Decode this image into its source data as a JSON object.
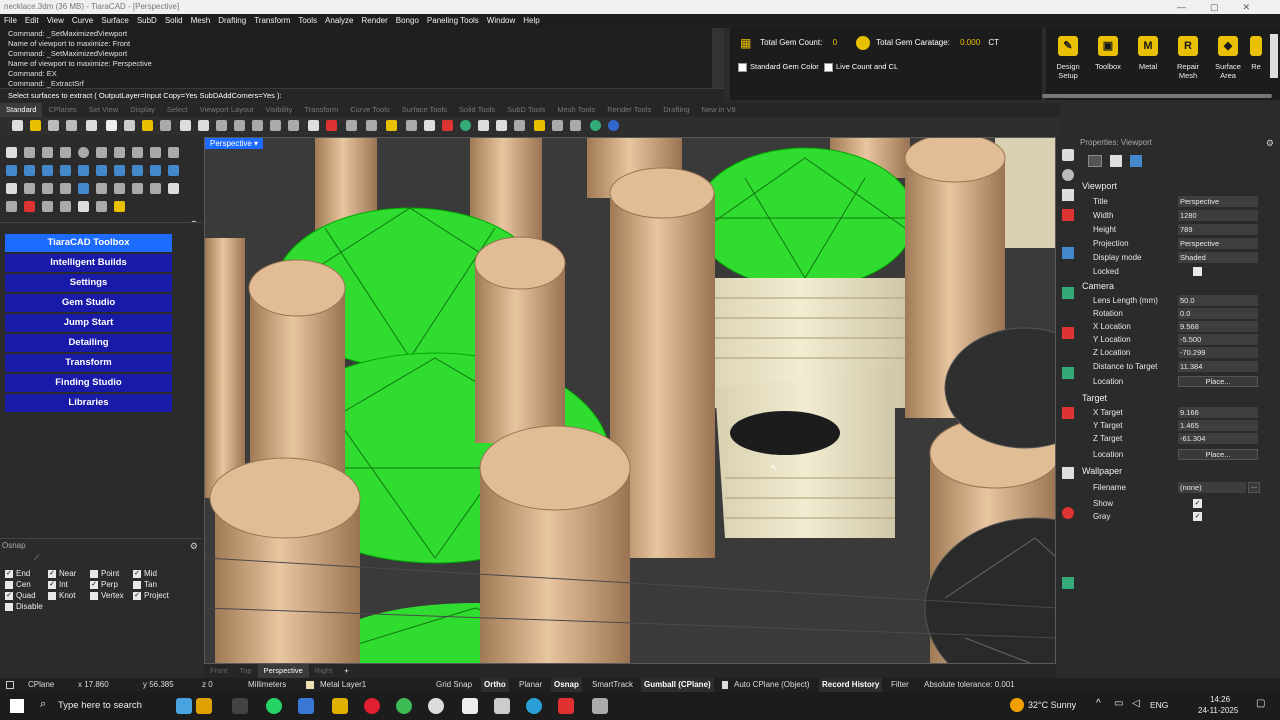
{
  "titlebar": {
    "title": "necklace.3dm (36 MB) - TiaraCAD - [Perspective]"
  },
  "menu": [
    "File",
    "Edit",
    "View",
    "Curve",
    "Surface",
    "SubD",
    "Solid",
    "Mesh",
    "Drafting",
    "Transform",
    "Tools",
    "Analyze",
    "Render",
    "Bongo",
    "Paneling Tools",
    "Window",
    "Help"
  ],
  "command": {
    "history": [
      "Command: _SetMaximizedViewport",
      "Name of viewport to maximize: Front",
      "Command: _SetMaximizedViewport",
      "Name of viewport to maximize: Perspective",
      "Command: EX",
      "Command: _ExtractSrf"
    ],
    "prompt": "Select surfaces to extract ( OutputLayer=Input  Copy=Yes  SubDAddCorners=Yes ):"
  },
  "gem": {
    "total_count_label": "Total Gem Count:",
    "total_count_value": "0",
    "caratage_label": "Total Gem Caratage:",
    "caratage_value": "0.000",
    "caratage_unit": "CT",
    "std_color_label": "Standard Gem Color",
    "live_count_label": "Live Count and CL"
  },
  "ribbon": [
    {
      "label": "Design Setup",
      "glyph": "✎"
    },
    {
      "label": "Toolbox",
      "glyph": "▣"
    },
    {
      "label": "Metal",
      "glyph": "M"
    },
    {
      "label": "Repair Mesh",
      "glyph": "R"
    },
    {
      "label": "Surface Area",
      "glyph": "◆"
    },
    {
      "label": "Re",
      "glyph": ""
    }
  ],
  "tabs": [
    "Standard",
    "CPlanes",
    "Set View",
    "Display",
    "Select",
    "Viewport Layout",
    "Visibility",
    "Transform",
    "Curve Tools",
    "Surface Tools",
    "Solid Tools",
    "SubD Tools",
    "Mesh Tools",
    "Render Tools",
    "Drafting",
    "New in V8"
  ],
  "tiara_toolbox": [
    "TiaraCAD Toolbox",
    "Intelligent Builds",
    "Settings",
    "Gem Studio",
    "Jump Start",
    "Detailing",
    "Transform",
    "Finding Studio",
    "Libraries"
  ],
  "osnap": {
    "title": "Osnap",
    "items": [
      {
        "label": "End",
        "checked": true
      },
      {
        "label": "Near",
        "checked": true
      },
      {
        "label": "Point",
        "checked": false
      },
      {
        "label": "Mid",
        "checked": true
      },
      {
        "label": "Cen",
        "checked": false
      },
      {
        "label": "Int",
        "checked": true
      },
      {
        "label": "Perp",
        "checked": true
      },
      {
        "label": "Tan",
        "checked": false
      },
      {
        "label": "Quad",
        "checked": true
      },
      {
        "label": "Knot",
        "checked": false
      },
      {
        "label": "Vertex",
        "checked": false
      },
      {
        "label": "Project",
        "checked": true
      },
      {
        "label": "Disable",
        "checked": false
      }
    ]
  },
  "viewport": {
    "label": "Perspective",
    "tabs": [
      "Front",
      "Top",
      "Perspective",
      "Right",
      "+"
    ]
  },
  "props": {
    "header": "Properties: Viewport",
    "viewport_section": "Viewport",
    "title_label": "Title",
    "title_value": "Perspective",
    "width_label": "Width",
    "width_value": "1280",
    "height_label": "Height",
    "height_value": "789",
    "projection_label": "Projection",
    "projection_value": "Perspective",
    "display_label": "Display mode",
    "display_value": "Shaded",
    "locked_label": "Locked",
    "camera_section": "Camera",
    "lens_label": "Lens Length (mm)",
    "lens_value": "50.0",
    "rotation_label": "Rotation",
    "rotation_value": "0.0",
    "xloc_label": "X Location",
    "xloc_value": "9.568",
    "yloc_label": "Y Location",
    "yloc_value": "-5.500",
    "zloc_label": "Z Location",
    "zloc_value": "-70.299",
    "dist_label": "Distance to Target",
    "dist_value": "11.384",
    "location_label": "Location",
    "place_button": "Place...",
    "target_section": "Target",
    "xt_label": "X Target",
    "xt_value": "9.166",
    "yt_label": "Y Target",
    "yt_value": "1.465",
    "zt_label": "Z Target",
    "zt_value": "-61.304",
    "wallpaper_section": "Wallpaper",
    "filename_label": "Filename",
    "filename_value": "(none)",
    "show_label": "Show",
    "gray_label": "Gray"
  },
  "status": {
    "cplane": "CPlane",
    "x": "x 17.860",
    "y": "y 56.385",
    "z": "z 0",
    "units": "Millimeters",
    "layer": "Metal Layer1",
    "grid_snap": "Grid Snap",
    "ortho": "Ortho",
    "planar": "Planar",
    "osnap": "Osnap",
    "smarttrack": "SmartTrack",
    "gumball": "Gumball (CPlane)",
    "autocplane": "Auto CPlane (Object)",
    "record_history": "Record History",
    "filter": "Filter",
    "tolerance": "Absolute tolerance: 0.001"
  },
  "taskbar": {
    "search_placeholder": "Type here to search",
    "weather": "32°C  Sunny",
    "lang": "ENG",
    "time": "14:26",
    "date": "24-11-2025"
  }
}
